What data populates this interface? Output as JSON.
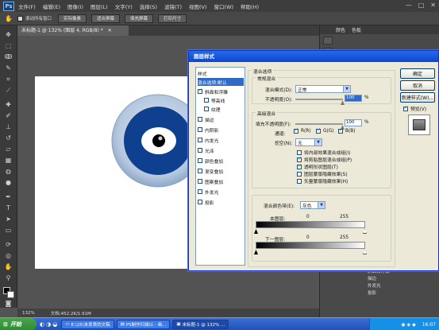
{
  "app": {
    "logo": "Ps",
    "menu": [
      "文件(F)",
      "编辑(E)",
      "图像(I)",
      "图层(L)",
      "文字(Y)",
      "选择(S)",
      "滤镜(T)",
      "视图(V)",
      "窗口(W)",
      "帮助(H)"
    ],
    "window_controls": [
      "—",
      "□",
      "✕"
    ]
  },
  "options_bar": {
    "checkbox_label": "滚动所有窗口",
    "buttons": [
      "实际像素",
      "适合屏幕",
      "填充屏幕",
      "打印尺寸"
    ]
  },
  "document": {
    "tab_title": "未标题-1 @ 132% (图层 4, RGB/8) *",
    "tab_close": "✕",
    "zoom": "132%",
    "doc_info": "文档:452.2K/1.91M"
  },
  "right_panel": {
    "tabs": [
      "颜色",
      "色板"
    ],
    "layer_items": [
      "斜面和浮雕",
      "描边",
      "外发光",
      "投影"
    ]
  },
  "dialog": {
    "title": "图层样式",
    "styles_header": "样式",
    "blend_options": "混合选项:默认",
    "style_items": [
      {
        "label": "斜面和浮雕",
        "checked": true
      },
      {
        "label": "等高线",
        "checked": false
      },
      {
        "label": "纹理",
        "checked": false
      },
      {
        "label": "描边",
        "checked": false
      },
      {
        "label": "内阴影",
        "checked": false
      },
      {
        "label": "内发光",
        "checked": false
      },
      {
        "label": "光泽",
        "checked": false
      },
      {
        "label": "颜色叠加",
        "checked": false
      },
      {
        "label": "渐变叠加",
        "checked": false
      },
      {
        "label": "图案叠加",
        "checked": false
      },
      {
        "label": "外发光",
        "checked": false
      },
      {
        "label": "投影",
        "checked": false
      }
    ],
    "section_title": "混合选项",
    "general": {
      "title": "常规混合",
      "mode_label": "混合模式(D):",
      "mode_value": "正常",
      "opacity_label": "不透明度(O):",
      "opacity_value": "100",
      "unit": "%"
    },
    "advanced": {
      "title": "高级混合",
      "fill_label": "填充不透明度(F):",
      "fill_value": "100",
      "unit": "%",
      "channels_label": "通道:",
      "channels": [
        "R(R)",
        "G(G)",
        "B(B)"
      ],
      "knockout_label": "挖空(N):",
      "knockout_value": "无",
      "options": [
        {
          "label": "将内部效果混合成组(I)",
          "checked": false
        },
        {
          "label": "将剪贴图层混合成组(P)",
          "checked": true
        },
        {
          "label": "透明形状图层(T)",
          "checked": true
        },
        {
          "label": "图层蒙版隐藏效果(S)",
          "checked": false
        },
        {
          "label": "矢量蒙版隐藏效果(H)",
          "checked": false
        }
      ]
    },
    "blend_if": {
      "label": "混合颜色带(E):",
      "value": "灰色",
      "this_layer": "本图层:",
      "underlying": "下一图层:",
      "min": "0",
      "max": "255"
    },
    "buttons": {
      "ok": "确定",
      "cancel": "取消",
      "new_style": "新建样式(W)...",
      "preview": "预览(V)"
    }
  },
  "taskbar": {
    "start": "开始",
    "items": [
      "E:\\25\\未发表的文稿",
      "PS制作扫描以 - 画...",
      "未标题-1 @ 132% ..."
    ],
    "clock": "16:07"
  },
  "colors": {
    "accent": "#316ac5",
    "eye_outer": "#b6c9df",
    "eye_ring": "#0f3f8f",
    "eye_white": "#ffffff",
    "pupil": "#000000"
  }
}
